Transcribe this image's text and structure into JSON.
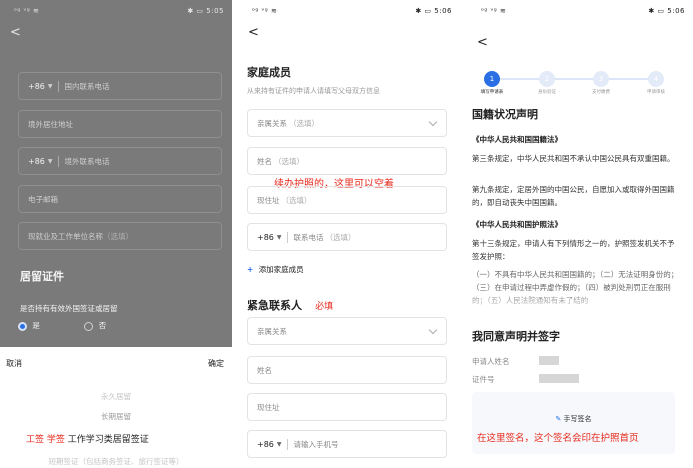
{
  "status": {
    "left": "ᵒᵍ ᵛᵍ ≋",
    "right_p1": "✱ ▭ 5:05",
    "right_p2": "✱ ▭ 5:06",
    "right_p3": "✱ ▭ 5:06"
  },
  "back_glyph": "<",
  "phone1": {
    "cc": "+86",
    "domestic_phone": "国内联系电话",
    "overseas_address": "境外居住地址",
    "overseas_phone": "境外联系电话",
    "email": "电子邮箱",
    "work_unit": "现就业及工作单位名称",
    "work_unit_sub": "（选填）",
    "residence_title": "居留证件",
    "residence_question": "是否持有有效外国签证或居留",
    "radio_yes": "是",
    "radio_no": "否",
    "cancel": "取消",
    "confirm": "确定",
    "picker_items": [
      "永久居留",
      "长期居留"
    ],
    "picker_selected_note": "工签 学签",
    "picker_selected": "工作学习类居留签证",
    "picker_next": "短期签证（包括商务签证、旅行签证等）"
  },
  "phone2": {
    "family_title": "家庭成员",
    "family_subtitle": "从来持有证件的申请人请填写父母双方信息",
    "relation": "亲属关系",
    "relation_sub": "（选填）",
    "name": "姓名",
    "name_sub": "（选填）",
    "note": "续办护照的，这里可以空着",
    "address": "现住址",
    "address_sub": "（选填）",
    "cc": "+86",
    "phone": "联系电话",
    "phone_sub": "（选填）",
    "add_member": "添加家庭成员",
    "emergency_title": "紧急联系人",
    "required": "必填",
    "em_relation": "亲属关系",
    "em_name": "姓名",
    "em_address": "现住址",
    "em_phone": "请输入手机号"
  },
  "phone3": {
    "steps": [
      "1",
      "2",
      "3",
      "4"
    ],
    "step_labels": [
      "填写申请表",
      "身份验证",
      "支付缴费",
      "申请审核"
    ],
    "title": "国籍状况声明",
    "law1": "《中华人民共和国国籍法》",
    "para1": "第三条规定，中华人民共和国不承认中国公民具有双重国籍。",
    "para2": "第九条规定，定居外国的中国公民，自愿加入或取得外国国籍的，即自动丧失中国国籍。",
    "law2": "《中华人民共和国护照法》",
    "para3": "第十三条规定，申请人有下列情形之一的，护照签发机关不予签发护照：",
    "para4": "（一）不具有中华人民共和国国籍的；（二）无法证明身份的；（三）在申请过程中弄虚作假的；（四）被判处刑罚正在服刑的；（五）人民法院通知有未了结的",
    "sign_title": "我同意声明并签字",
    "applicant_label": "申请人姓名",
    "cert_label": "证件号",
    "sign_button": "手写签名",
    "sign_note": "在这里签名，这个签名会印在护照首页"
  }
}
